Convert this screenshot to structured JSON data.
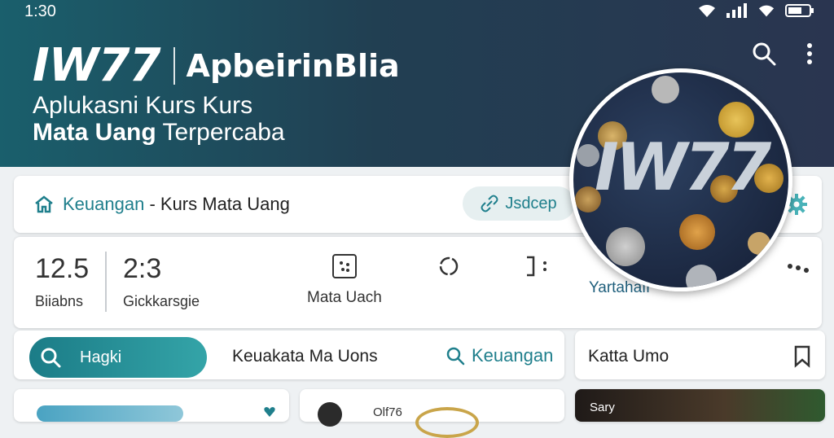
{
  "status": {
    "time": "1:30"
  },
  "header": {
    "logo": "IW77",
    "brand_name": "ApbeirinBlia",
    "tagline_line1": "Aplukasni Kurs Kurs",
    "tagline_bold": "Mata Uang",
    "tagline_rest": " Terpercaba",
    "icons": [
      "search-icon",
      "more-vert-icon"
    ]
  },
  "promo_image": {
    "logo": "IW77"
  },
  "breadcrumb": {
    "icon": "home-icon",
    "section": "Keuangan",
    "separator": " - ",
    "page": "Kurs Mata Uang"
  },
  "action_pill": {
    "icon": "link-icon",
    "label": "Jsdcep"
  },
  "stats": [
    {
      "value": "12.5",
      "label": "Biiabns"
    },
    {
      "value": "2:3",
      "label": "Gickkarsgie"
    }
  ],
  "tools": [
    {
      "icon": "grid-dots-icon",
      "label": "Mata Uach"
    },
    {
      "icon": "circle-icon",
      "label": ""
    },
    {
      "icon": "bracket-icon",
      "label": ""
    },
    {
      "icon": "wallet-icon",
      "label": "Yartahafr"
    },
    {
      "icon": "more-horiz-icon",
      "label": ""
    }
  ],
  "search": {
    "button_label": "Hagki",
    "currency_label": "Keuakata Ma Uons",
    "link_label": "Keuangan"
  },
  "kata": {
    "label": "Katta Umo"
  },
  "bottom": {
    "card3_label": "Olf76",
    "card4_label": "Sary"
  },
  "colors": {
    "accent": "#1f7f8c",
    "header_start": "#1a5f6c",
    "header_end": "#2a3550"
  }
}
